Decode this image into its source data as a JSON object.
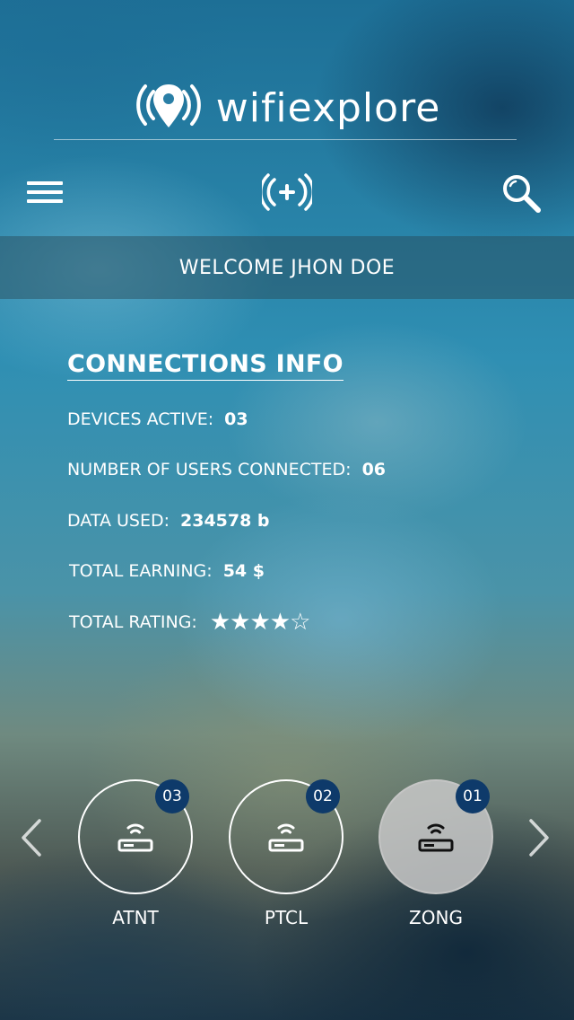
{
  "app": {
    "logo_text": "wifiexplore",
    "logo_icon": "wifi-location-pin-icon"
  },
  "toolbar": {
    "menu_icon": "hamburger-menu-icon",
    "add_icon": "add-hotspot-icon",
    "search_icon": "search-icon"
  },
  "welcome": {
    "text": "WELCOME JHON DOE"
  },
  "connections": {
    "title": "CONNECTIONS INFO",
    "devices_label": "DEVICES ACTIVE:",
    "devices_value": "03",
    "users_label": "NUMBER OF USERS CONNECTED:",
    "users_value": "06",
    "data_label": "DATA USED:",
    "data_value": "234578 b",
    "earning_label": "TOTAL EARNING:",
    "earning_value": "54 $",
    "rating_label": "TOTAL RATING:",
    "rating_value": 4,
    "rating_max": 5,
    "rating_stars": "★★★★☆"
  },
  "carousel": {
    "prev_icon": "chevron-left-icon",
    "next_icon": "chevron-right-icon",
    "networks": [
      {
        "name": "ATNT",
        "count": "03",
        "icon": "router-icon",
        "selected": false
      },
      {
        "name": "PTCL",
        "count": "02",
        "icon": "router-icon",
        "selected": false
      },
      {
        "name": "ZONG",
        "count": "01",
        "icon": "router-icon",
        "selected": true
      }
    ]
  },
  "colors": {
    "badge": "#0e3a6a",
    "selected_circle": "#c8c8c8",
    "text": "#ffffff"
  }
}
